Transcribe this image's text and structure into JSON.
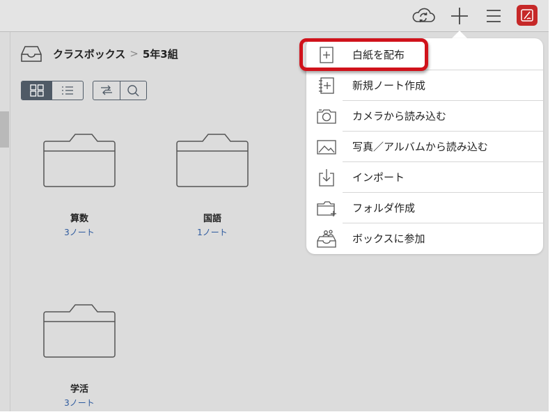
{
  "toolbar": {
    "sync_icon": "cloud-sync-icon",
    "add_icon": "plus-icon",
    "menu_icon": "hamburger-menu-icon",
    "app_icon": "metamoji-app-icon",
    "app_color": "#c62828"
  },
  "breadcrumb": {
    "root": "クラスボックス",
    "separator": ">",
    "current": "5年3組"
  },
  "folders": [
    {
      "name": "算数",
      "count": "3ノート"
    },
    {
      "name": "国語",
      "count": "1ノート"
    },
    {
      "name": "学活",
      "count": "3ノート"
    }
  ],
  "menu": {
    "items": [
      {
        "label": "白紙を配布",
        "icon": "blank-page-plus-icon"
      },
      {
        "label": "新規ノート作成",
        "icon": "new-notebook-icon"
      },
      {
        "label": "カメラから読み込む",
        "icon": "camera-icon"
      },
      {
        "label": "写真／アルバムから読み込む",
        "icon": "photo-icon"
      },
      {
        "label": "インポート",
        "icon": "import-icon"
      },
      {
        "label": "フォルダ作成",
        "icon": "folder-add-icon"
      },
      {
        "label": "ボックスに参加",
        "icon": "join-box-icon"
      }
    ]
  },
  "highlight_color": "#d0121b"
}
